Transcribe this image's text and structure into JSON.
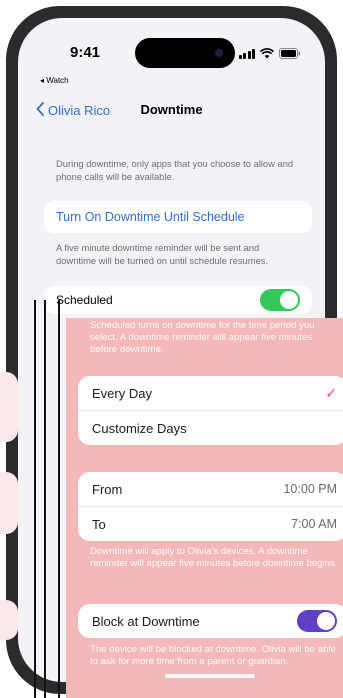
{
  "status_bar": {
    "time": "9:41"
  },
  "back_app": "◂ Watch",
  "nav": {
    "back_label": "Olivia Rico",
    "title": "Downtime"
  },
  "intro_text": "During downtime, only apps that you choose to allow and phone calls will be available.",
  "turn_on_button": "Turn On Downtime Until Schedule",
  "reminder_text": "A five minute downtime reminder will be sent and downtime will be turned on until schedule resumes.",
  "scheduled": {
    "label": "Scheduled",
    "on": true
  },
  "scheduled_note": "Scheduled turns on downtime for the time period you select. A downtime reminder will appear five minutes before downtime.",
  "days_options": [
    {
      "label": "Every Day",
      "selected": true
    },
    {
      "label": "Customize Days",
      "selected": false
    }
  ],
  "time_range": {
    "from_label": "From",
    "from_value": "10:00 PM",
    "to_label": "To",
    "to_value": "7:00 AM"
  },
  "apply_note": "Downtime will apply to Olivia's devices. A downtime reminder will appear five minutes before downtime begins.",
  "block": {
    "label": "Block at Downtime",
    "on": true
  },
  "block_note": "The device will be blocked at downtime. Olivia will be able to ask for more time from a parent or guardian.",
  "colors": {
    "accent": "#2f6fd6",
    "toggle_purple": "#5f3fc4",
    "toggle_green": "#34c759",
    "overlay": "#f4b8b8",
    "check": "#e4557a"
  },
  "icons": [
    "chevron-left-icon",
    "signal-icon",
    "wifi-icon",
    "battery-icon",
    "checkmark-icon"
  ]
}
